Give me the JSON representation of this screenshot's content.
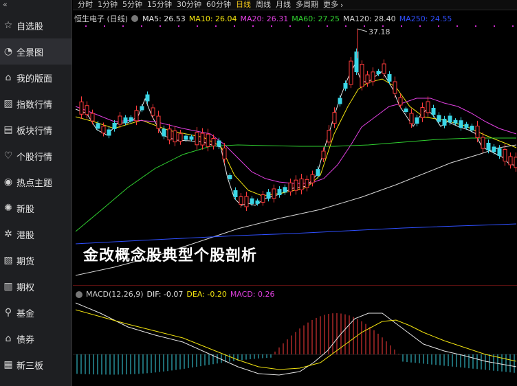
{
  "sidebar": {
    "collapse_glyph": "«",
    "items": [
      {
        "label": "自选股",
        "icon": "star-icon"
      },
      {
        "label": "全景图",
        "icon": "panorama-icon",
        "active": true
      },
      {
        "label": "我的版面",
        "icon": "home-icon"
      },
      {
        "label": "指数行情",
        "icon": "index-chart-icon"
      },
      {
        "label": "板块行情",
        "icon": "sector-icon"
      },
      {
        "label": "个股行情",
        "icon": "stock-icon"
      },
      {
        "label": "热点主题",
        "icon": "hot-topic-icon"
      },
      {
        "label": "新股",
        "icon": "new-stock-icon"
      },
      {
        "label": "港股",
        "icon": "hk-stock-icon"
      },
      {
        "label": "期货",
        "icon": "futures-icon"
      },
      {
        "label": "期权",
        "icon": "options-icon"
      },
      {
        "label": "基金",
        "icon": "fund-icon"
      },
      {
        "label": "债券",
        "icon": "bond-icon"
      },
      {
        "label": "新三板",
        "icon": "neeq-icon"
      }
    ]
  },
  "timeframes": [
    {
      "label": "分时"
    },
    {
      "label": "1分钟"
    },
    {
      "label": "5分钟"
    },
    {
      "label": "15分钟"
    },
    {
      "label": "30分钟"
    },
    {
      "label": "60分钟"
    },
    {
      "label": "日线",
      "active": true
    },
    {
      "label": "周线"
    },
    {
      "label": "月线"
    },
    {
      "label": "多周期"
    },
    {
      "label": "更多"
    }
  ],
  "chart": {
    "stock_name": "恒生电子 (日线)",
    "ma_legend": [
      {
        "text": "MA5: 26.53",
        "color": "#e6e6e6"
      },
      {
        "text": "MA10: 26.04",
        "color": "#f2e30f"
      },
      {
        "text": "MA20: 26.31",
        "color": "#e040e0"
      },
      {
        "text": "MA60: 27.25",
        "color": "#30d030"
      },
      {
        "text": "MA120: 28.40",
        "color": "#d8d8d8"
      },
      {
        "text": "MA250: 24.55",
        "color": "#2f4fff"
      }
    ],
    "high_marker": "37.18",
    "macd_legend": [
      {
        "text": "MACD(12,26,9)",
        "color": "#cfcfcf"
      },
      {
        "text": "DIF: -0.07",
        "color": "#e6e6e6"
      },
      {
        "text": "DEA: -0.20",
        "color": "#f2e30f"
      },
      {
        "text": "MACD: 0.26",
        "color": "#e040e0"
      }
    ],
    "overlay_title": "金改概念股典型个股剖析",
    "colors": {
      "up": "#ff3b3b",
      "down": "#3ad6e6",
      "ma5": "#e6e6e6",
      "ma10": "#f2e30f",
      "ma20": "#e040e0",
      "ma60": "#30d030",
      "ma120": "#d8d8d8",
      "ma250": "#2f4fff"
    }
  }
}
